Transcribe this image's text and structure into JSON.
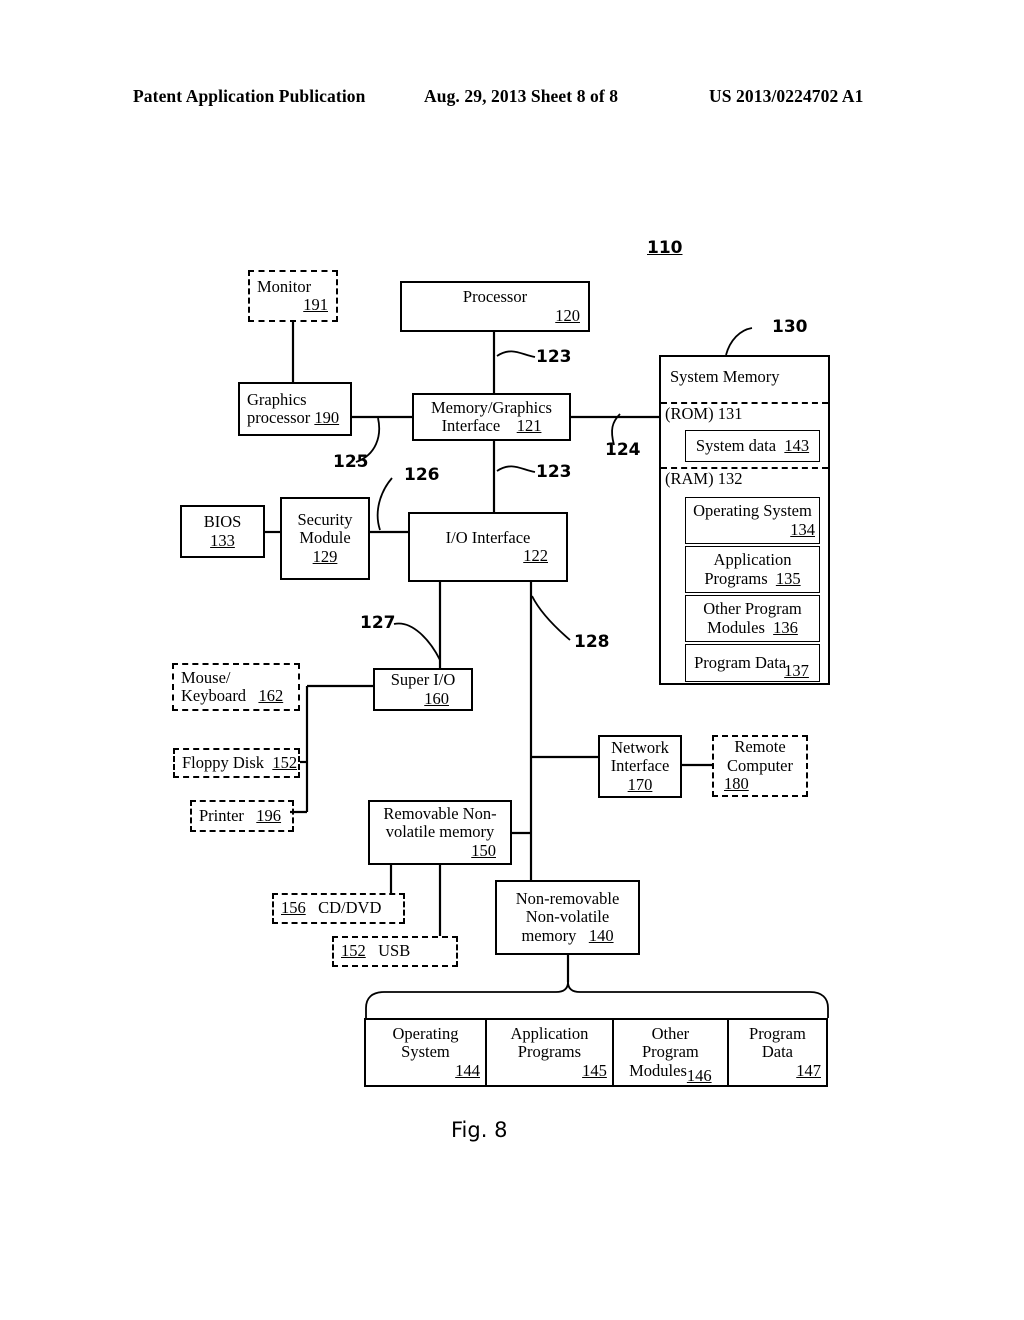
{
  "header": {
    "left": "Patent Application Publication",
    "middle": "Aug. 29, 2013  Sheet 8 of 8",
    "right": "US 2013/0224702 A1"
  },
  "figure": {
    "caption": "Fig. 8",
    "system_label": "110"
  },
  "blocks": {
    "monitor": {
      "label": "Monitor",
      "ref": "191"
    },
    "processor": {
      "label": "Processor",
      "ref": "120"
    },
    "graphics": {
      "line1": "Graphics",
      "line2": "processor",
      "ref": "190"
    },
    "memgfx": {
      "line1": "Memory/Graphics",
      "line2": "Interface",
      "ref": "121"
    },
    "bios": {
      "label": "BIOS",
      "ref": "133"
    },
    "security": {
      "line1": "Security",
      "line2": "Module",
      "ref": "129"
    },
    "ioiface": {
      "label": "I/O Interface",
      "ref": "122"
    },
    "superio": {
      "label": "Super I/O",
      "ref": "160"
    },
    "mouse_kbd": {
      "line1": "Mouse/",
      "line2": "Keyboard",
      "ref": "162"
    },
    "floppy": {
      "label": "Floppy Disk",
      "ref": "152"
    },
    "printer": {
      "label": "Printer",
      "ref": "196"
    },
    "removable": {
      "line1": "Removable Non-",
      "line2": "volatile memory",
      "ref": "150"
    },
    "cddvd": {
      "label": "CD/DVD",
      "ref": "156"
    },
    "usb": {
      "label": "USB",
      "ref": "152"
    },
    "nonremovable": {
      "line1": "Non-removable",
      "line2": "Non-volatile",
      "line3": "memory",
      "ref": "140"
    },
    "network": {
      "line1": "Network",
      "line2": "Interface",
      "ref": "170"
    },
    "remote": {
      "line1": "Remote",
      "line2": "Computer",
      "ref": "180"
    }
  },
  "system_memory": {
    "title": "System Memory",
    "ref": "130",
    "rom_label": "(ROM)",
    "rom_ref": "131",
    "ram_label": "(RAM)",
    "ram_ref": "132",
    "items": [
      {
        "label": "System data",
        "ref": "143"
      },
      {
        "label": "Operating System",
        "ref": "134"
      },
      {
        "line1": "Application",
        "line2": "Programs",
        "ref": "135"
      },
      {
        "line1": "Other Program",
        "line2": "Modules",
        "ref": "136"
      },
      {
        "label": "Program Data",
        "ref": "137"
      }
    ]
  },
  "storage_table": {
    "cells": [
      {
        "line1": "Operating",
        "line2": "System",
        "ref": "144"
      },
      {
        "line1": "Application",
        "line2": "Programs",
        "ref": "145"
      },
      {
        "line1": "Other",
        "line2": "Program",
        "line3": "Modules",
        "ref": "146"
      },
      {
        "line1": "Program",
        "line2": "Data",
        "ref": "147"
      }
    ]
  },
  "bus_labels": {
    "b123_top": "123",
    "b123_bottom": "123",
    "b124": "124",
    "b125": "125",
    "b126": "126",
    "b127": "127",
    "b128": "128",
    "b130": "130"
  }
}
